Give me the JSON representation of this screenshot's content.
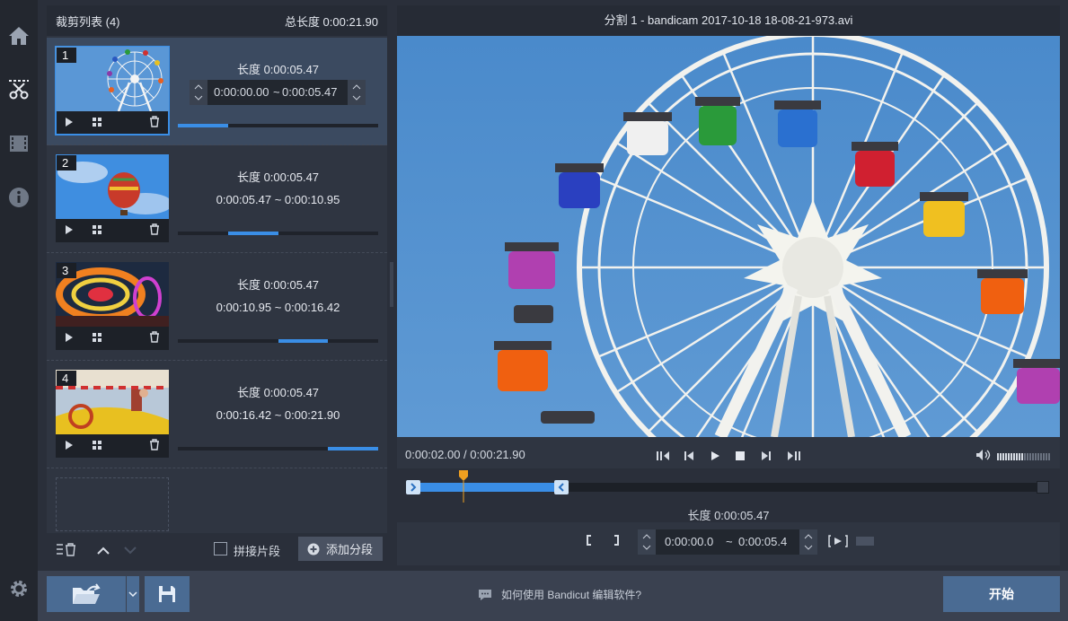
{
  "clip_list": {
    "title": "裁剪列表 (4)",
    "total_length": "总长度 0:00:21.90",
    "clips": [
      {
        "number": "1",
        "length": "长度 0:00:05.47",
        "start": "0:00:00.00",
        "sep": "~",
        "end": "0:00:05.47",
        "progress_start": 0.0,
        "progress_end": 0.25
      },
      {
        "number": "2",
        "length": "长度 0:00:05.47",
        "range": "0:00:05.47 ~ 0:00:10.95",
        "progress_start": 0.25,
        "progress_end": 0.5
      },
      {
        "number": "3",
        "length": "长度 0:00:05.47",
        "range": "0:00:10.95 ~ 0:00:16.42",
        "progress_start": 0.5,
        "progress_end": 0.75
      },
      {
        "number": "4",
        "length": "长度 0:00:05.47",
        "range": "0:00:16.42 ~ 0:00:21.90",
        "progress_start": 0.75,
        "progress_end": 1.0
      }
    ],
    "footer": {
      "merge_label": "拼接片段",
      "add_segment_label": "添加分段"
    }
  },
  "player": {
    "title": "分割 1 - bandicam 2017-10-18 18-08-21-973.avi",
    "time_display": "0:00:02.00 / 0:00:21.90",
    "segment_length": "长度 0:00:05.47",
    "segment_start": "0:00:00.0",
    "segment_sep": "~",
    "segment_end": "0:00:05.4",
    "playhead_fraction": 0.09,
    "selection_end_fraction": 0.25
  },
  "bottom_bar": {
    "help_text": "如何使用 Bandicut 编辑软件?",
    "start_label": "开始"
  },
  "colors": {
    "accent": "#3a8ee6",
    "playhead": "#f0a020",
    "start_button": "#4a6b93"
  }
}
